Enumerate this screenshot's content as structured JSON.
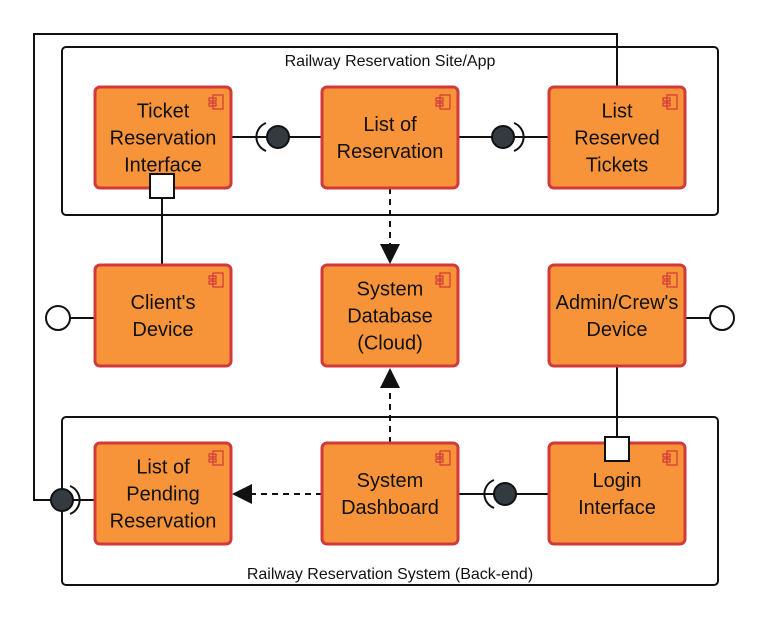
{
  "frames": {
    "top": "Railway Reservation Site/App",
    "bottom": "Railway Reservation System (Back-end)"
  },
  "components": [
    {
      "id": "ticket",
      "lines": [
        "Ticket",
        "Reservation",
        "Interface"
      ]
    },
    {
      "id": "list-res",
      "lines": [
        "List of",
        "Reservation"
      ]
    },
    {
      "id": "reserved",
      "lines": [
        "List",
        "Reserved",
        "Tickets"
      ]
    },
    {
      "id": "client",
      "lines": [
        "Client's",
        "Device"
      ]
    },
    {
      "id": "db",
      "lines": [
        "System",
        "Database",
        "(Cloud)"
      ]
    },
    {
      "id": "admin",
      "lines": [
        "Admin/Crew's",
        "Device"
      ]
    },
    {
      "id": "pending",
      "lines": [
        "List of",
        "Pending",
        "Reservation"
      ]
    },
    {
      "id": "dash",
      "lines": [
        "System",
        "Dashboard"
      ]
    },
    {
      "id": "login",
      "lines": [
        "Login",
        "Interface"
      ]
    }
  ],
  "colors": {
    "component_fill": "#f7943a",
    "component_border": "#d2393a",
    "line": "#111111"
  },
  "icons": {
    "component": "component-icon"
  }
}
